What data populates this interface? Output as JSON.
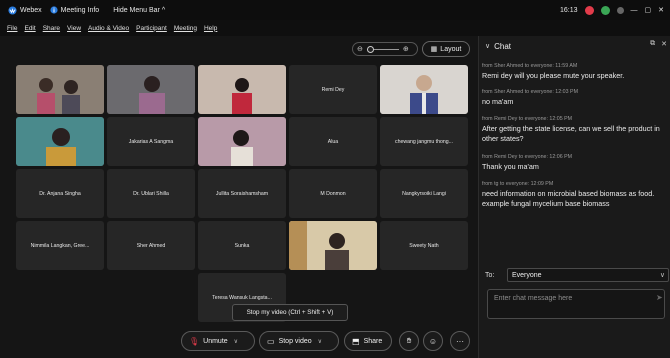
{
  "titlebar": {
    "app_name": "Webex",
    "meeting_info": "Meeting Info",
    "hide_menu": "Hide Menu Bar ^",
    "time": "16:13"
  },
  "menubar": [
    "File",
    "Edit",
    "Share",
    "View",
    "Audio & Video",
    "Participant",
    "Meeting",
    "Help"
  ],
  "stage": {
    "layout_label": "Layout",
    "tiles": [
      {
        "name": "",
        "video": true
      },
      {
        "name": "",
        "video": true
      },
      {
        "name": "",
        "video": true
      },
      {
        "name": "Remi Dey",
        "video": false
      },
      {
        "name": "",
        "video": true
      },
      {
        "name": "",
        "video": true
      },
      {
        "name": "Jakarias A Sangma",
        "video": false
      },
      {
        "name": "",
        "video": true
      },
      {
        "name": "Alua",
        "video": false
      },
      {
        "name": "chewang jangmu thong...",
        "video": false
      },
      {
        "name": "Dr. Anjana Singha",
        "video": false
      },
      {
        "name": "Dr. Ublari Shilla",
        "video": false
      },
      {
        "name": "Jullita Soraisham​sham",
        "video": false
      },
      {
        "name": "M Donmon",
        "video": false
      },
      {
        "name": "Nangkyrsoiki Langi",
        "video": false
      },
      {
        "name": "Nimmila Langkan, Gree...",
        "video": false
      },
      {
        "name": "Sher Ahmed",
        "video": false
      },
      {
        "name": "Sunka",
        "video": false
      },
      {
        "name": "",
        "video": true
      },
      {
        "name": "Sweety Nath",
        "video": false
      },
      {
        "name": "Teresa Wansuk Langsta...",
        "video": false
      }
    ]
  },
  "toolbar": {
    "tooltip": "Stop my video (Ctrl + Shift + V)",
    "unmute": "Unmute",
    "stop_video": "Stop video",
    "share": "Share"
  },
  "chat": {
    "title": "Chat",
    "messages": [
      {
        "meta": "from Sher Ahmed to everyone:   11:59 AM",
        "text": "Remi dey will you please mute your speaker."
      },
      {
        "meta": "from Sher Ahmed to everyone:   12:03 PM",
        "text": "no ma'am"
      },
      {
        "meta": "from Remi Dey to everyone:   12:05 PM",
        "text": "After getting the state license, can we sell the product in other states?"
      },
      {
        "meta": "from Remi Dey to everyone:   12:06 PM",
        "text": "Thank you ma'am"
      },
      {
        "meta": "from tg to everyone:   12:09 PM",
        "text": "need information on microbial based biomass as food. example fungal mycelium base biomass"
      }
    ],
    "to_label": "To:",
    "to_value": "Everyone",
    "input_placeholder": "Enter chat message here"
  },
  "colors": {
    "end_call": "#e23b4a",
    "record": "#e23b4a",
    "status": "#3aa655"
  }
}
